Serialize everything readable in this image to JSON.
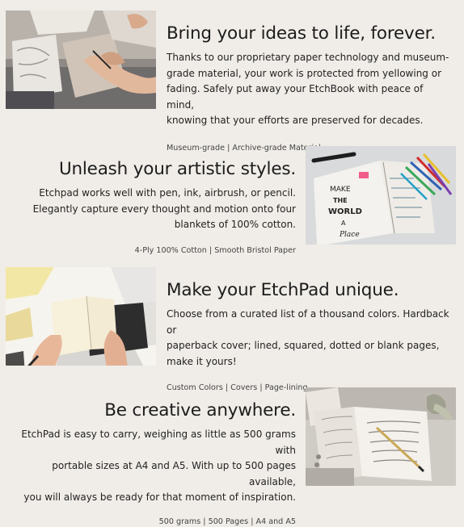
{
  "features": [
    {
      "title": "Bring your ideas to life, forever.",
      "body_lines": [
        "Thanks to our proprietary paper technology and museum-",
        "grade material, your work is protected from yellowing or",
        "fading. Safely put away your EtchBook with peace of mind,",
        "knowing that your efforts are preserved for decades."
      ],
      "tags": "Museum-grade | Archive-grade Material",
      "photo_icon": "sketching-hands-photo"
    },
    {
      "title": "Unleash your artistic styles.",
      "body_lines": [
        "Etchpad works well with pen, ink, airbrush, or pencil.",
        "Elegantly capture every thought and motion onto four",
        "blankets of 100% cotton."
      ],
      "tags": "4-Ply 100% Cotton | Smooth Bristol Paper",
      "photo_icon": "lettering-notebook-photo",
      "photo_text": [
        "MAKE",
        "THE",
        "WORLD",
        "A",
        "Place"
      ]
    },
    {
      "title": "Make your EtchPad unique.",
      "body_lines": [
        "Choose from a curated list of a thousand colors. Hardback or",
        "paperback cover; lined, squared, dotted or blank pages,",
        "make it yours!"
      ],
      "tags": "Custom Colors | Covers | Page-lining",
      "photo_icon": "open-notebook-hands-photo"
    },
    {
      "title": "Be creative anywhere.",
      "body_lines": [
        "EtchPad is easy to carry, weighing as little as 500 grams with",
        "portable sizes at A4 and A5. With up to 500 pages available,",
        "you will always be ready for that moment of inspiration."
      ],
      "tags": "500 grams | 500 Pages | A4 and A5",
      "photo_icon": "journal-with-pen-photo"
    }
  ],
  "colors": {
    "page_background": "#f0ede8",
    "heading": "#1c1c1c",
    "body_text": "#222222",
    "tag_text": "#444444"
  }
}
